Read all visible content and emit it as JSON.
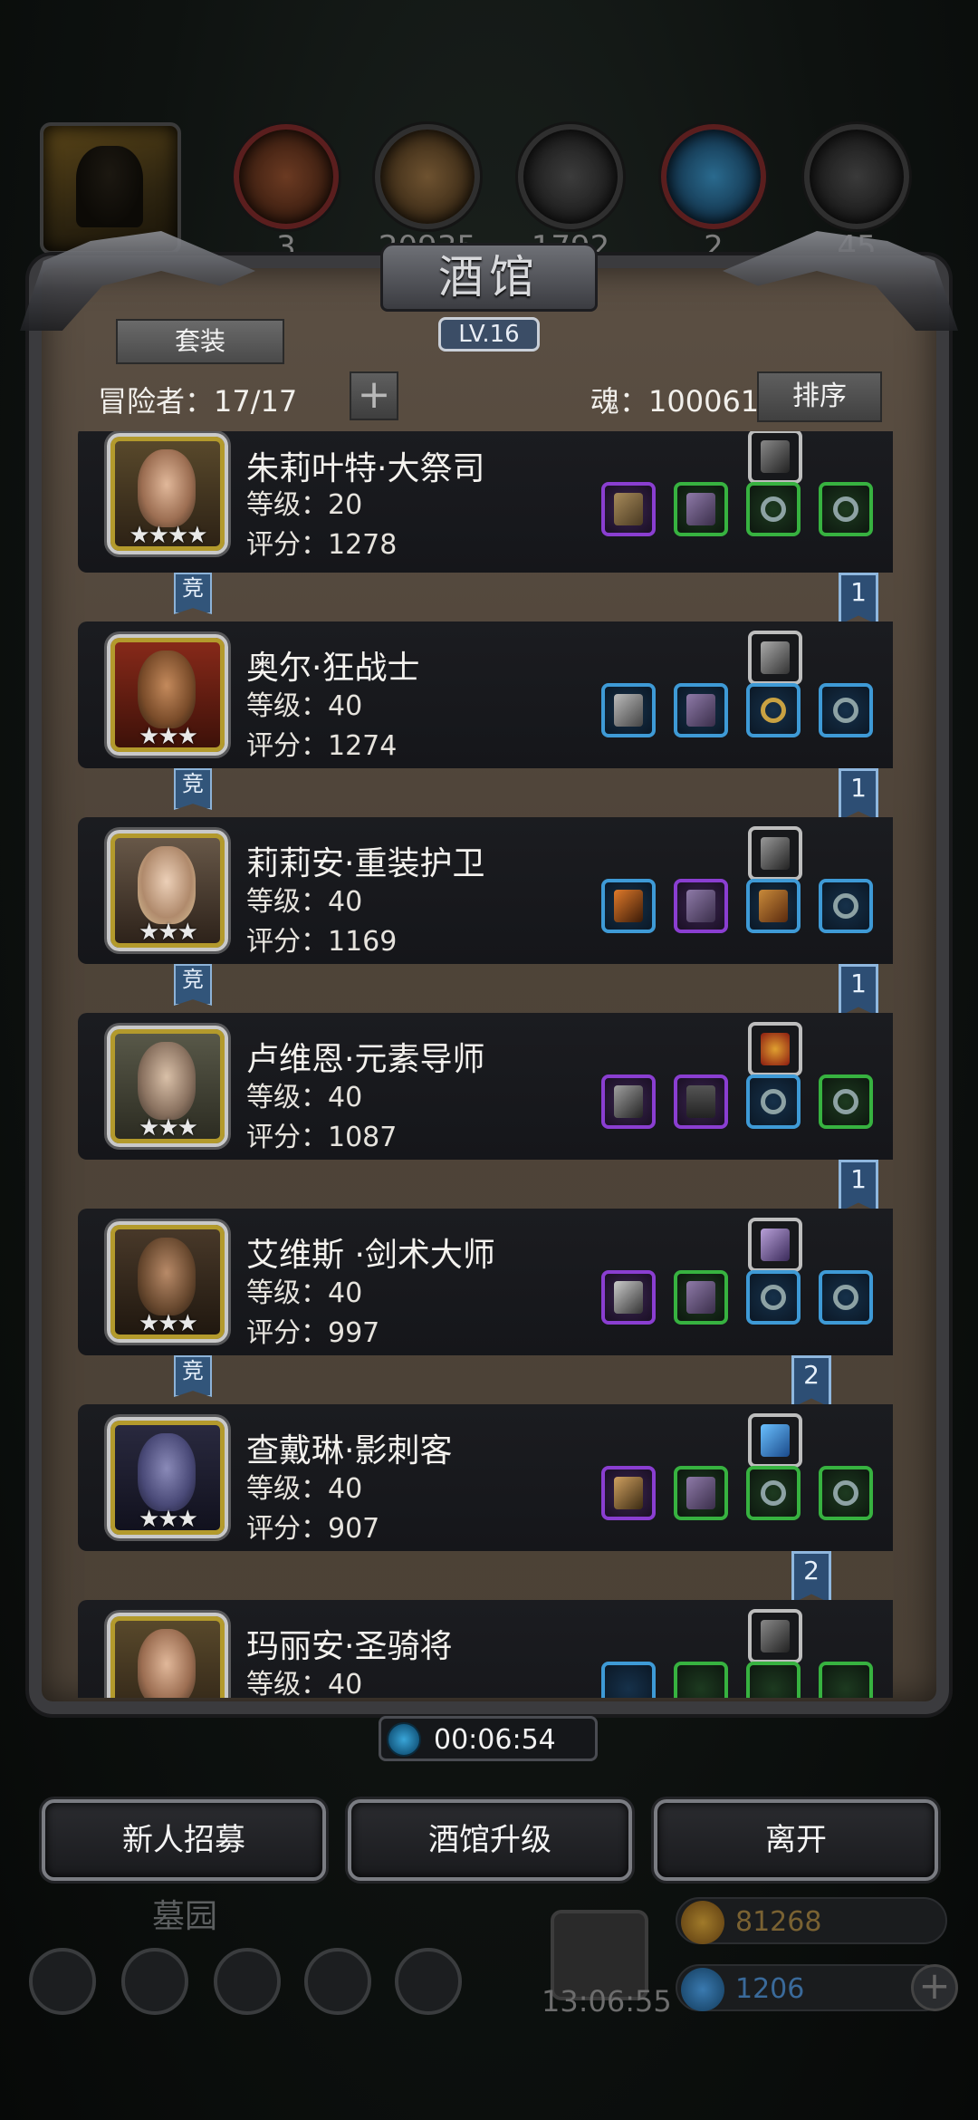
{
  "top_resources": [
    {
      "icon": "meat-icon",
      "count": "3"
    },
    {
      "icon": "wood-icon",
      "count": "20935"
    },
    {
      "icon": "iron-icon",
      "count": "1792"
    },
    {
      "icon": "crystal-icon",
      "count": "2"
    },
    {
      "icon": "stone-icon",
      "count": "45"
    }
  ],
  "tavern": {
    "title": "酒馆",
    "level": "LV.16",
    "suit_button": "套装",
    "adventurers": "冒险者：17/17",
    "soul": "魂：100061",
    "sort_button": "排序"
  },
  "heroes": [
    {
      "name": "朱莉叶特·大祭司",
      "level": "等级：20",
      "score": "评分：1278",
      "stars": "★★★★",
      "competitive": "竞",
      "rank": "1"
    },
    {
      "name": "奥尔·狂战士",
      "level": "等级：40",
      "score": "评分：1274",
      "stars": "★★★",
      "competitive": "竞",
      "rank": "1"
    },
    {
      "name": "莉莉安·重装护卫",
      "level": "等级：40",
      "score": "评分：1169",
      "stars": "★★★",
      "competitive": "竞",
      "rank": "1"
    },
    {
      "name": "卢维恩·元素导师",
      "level": "等级：40",
      "score": "评分：1087",
      "stars": "★★★",
      "competitive": "",
      "rank": "1"
    },
    {
      "name": "艾维斯 ·剑术大师",
      "level": "等级：40",
      "score": "评分：997",
      "stars": "★★★",
      "competitive": "竞",
      "rank": "2"
    },
    {
      "name": "查戴琳·影刺客",
      "level": "等级：40",
      "score": "评分：907",
      "stars": "★★★",
      "competitive": "",
      "rank": "2"
    },
    {
      "name": "玛丽安·圣骑将",
      "level": "等级：40",
      "score": "",
      "stars": "★★★",
      "competitive": "",
      "rank": ""
    }
  ],
  "timer": "00:06:54",
  "buttons": {
    "recruit": "新人招募",
    "upgrade": "酒馆升级",
    "leave": "离开"
  },
  "hud": {
    "cemetery": "墓园",
    "gift_timer": "13:06:55",
    "gold": "81268",
    "gems": "1206"
  }
}
